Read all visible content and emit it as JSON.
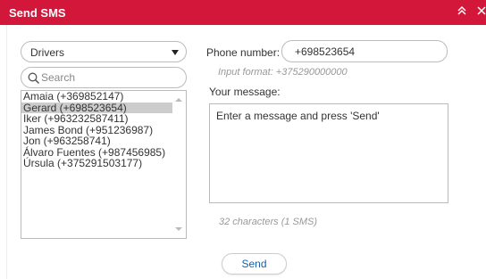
{
  "window": {
    "title": "Send SMS",
    "collapse_icon": "double-chevron-up-icon",
    "close_icon": "close-icon",
    "accent_color": "#d2173a"
  },
  "contacts": {
    "group_select": {
      "value": "Drivers"
    },
    "search": {
      "placeholder": "Search",
      "value": ""
    },
    "items": [
      {
        "label": "Amaia (+369852147)",
        "selected": false
      },
      {
        "label": "Gerard (+698523654)",
        "selected": true
      },
      {
        "label": "Iker (+963232587411)",
        "selected": false
      },
      {
        "label": "James Bond (+951236987)",
        "selected": false
      },
      {
        "label": "Jon (+963258741)",
        "selected": false
      },
      {
        "label": "Álvaro Fuentes (+987456985)",
        "selected": false
      },
      {
        "label": "Úrsula (+375291503177)",
        "selected": false
      }
    ]
  },
  "form": {
    "phone_label": "Phone number:",
    "phone_value": "+698523654",
    "format_hint": "Input format: +375290000000",
    "message_label": "Your message:",
    "message_value": "Enter a message and press 'Send'",
    "char_count": "32 characters (1 SMS)",
    "send_label": "Send"
  }
}
